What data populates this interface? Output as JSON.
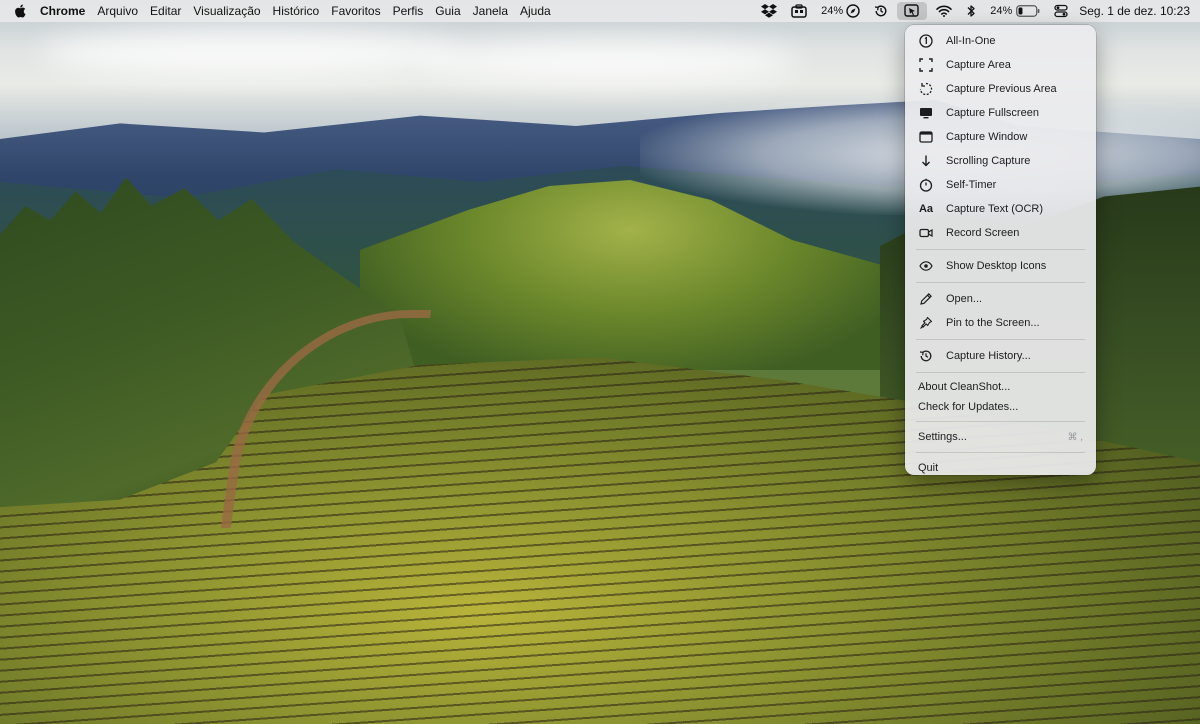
{
  "menubar": {
    "app_name": "Chrome",
    "menus": [
      "Arquivo",
      "Editar",
      "Visualização",
      "Histórico",
      "Favoritos",
      "Perfis",
      "Guia",
      "Janela",
      "Ajuda"
    ],
    "tray": {
      "battery_label_1": "24%",
      "battery_label_2": "24%",
      "battery_level": 0.24,
      "clock": "Seg. 1 de dez.  10:23"
    }
  },
  "dropdown": {
    "items": [
      {
        "label": "All-In-One",
        "icon": "all-in-one-icon"
      },
      {
        "label": "Capture Area",
        "icon": "capture-area-icon"
      },
      {
        "label": "Capture Previous Area",
        "icon": "capture-previous-area-icon"
      },
      {
        "label": "Capture Fullscreen",
        "icon": "monitor-icon"
      },
      {
        "label": "Capture Window",
        "icon": "window-icon"
      },
      {
        "label": "Scrolling Capture",
        "icon": "arrow-down-icon"
      },
      {
        "label": "Self-Timer",
        "icon": "timer-icon"
      },
      {
        "label": "Capture Text (OCR)",
        "icon": "text-aa-icon"
      },
      {
        "label": "Record Screen",
        "icon": "video-camera-icon"
      },
      {
        "label": "Show Desktop Icons",
        "icon": "eye-icon"
      },
      {
        "label": "Open...",
        "icon": "pencil-icon"
      },
      {
        "label": "Pin to the Screen...",
        "icon": "pin-icon"
      },
      {
        "label": "Capture History...",
        "icon": "history-icon"
      },
      {
        "label": "About CleanShot..."
      },
      {
        "label": "Check for Updates..."
      },
      {
        "label": "Settings...",
        "shortcut": "⌘ ,"
      },
      {
        "label": "Quit"
      }
    ]
  }
}
